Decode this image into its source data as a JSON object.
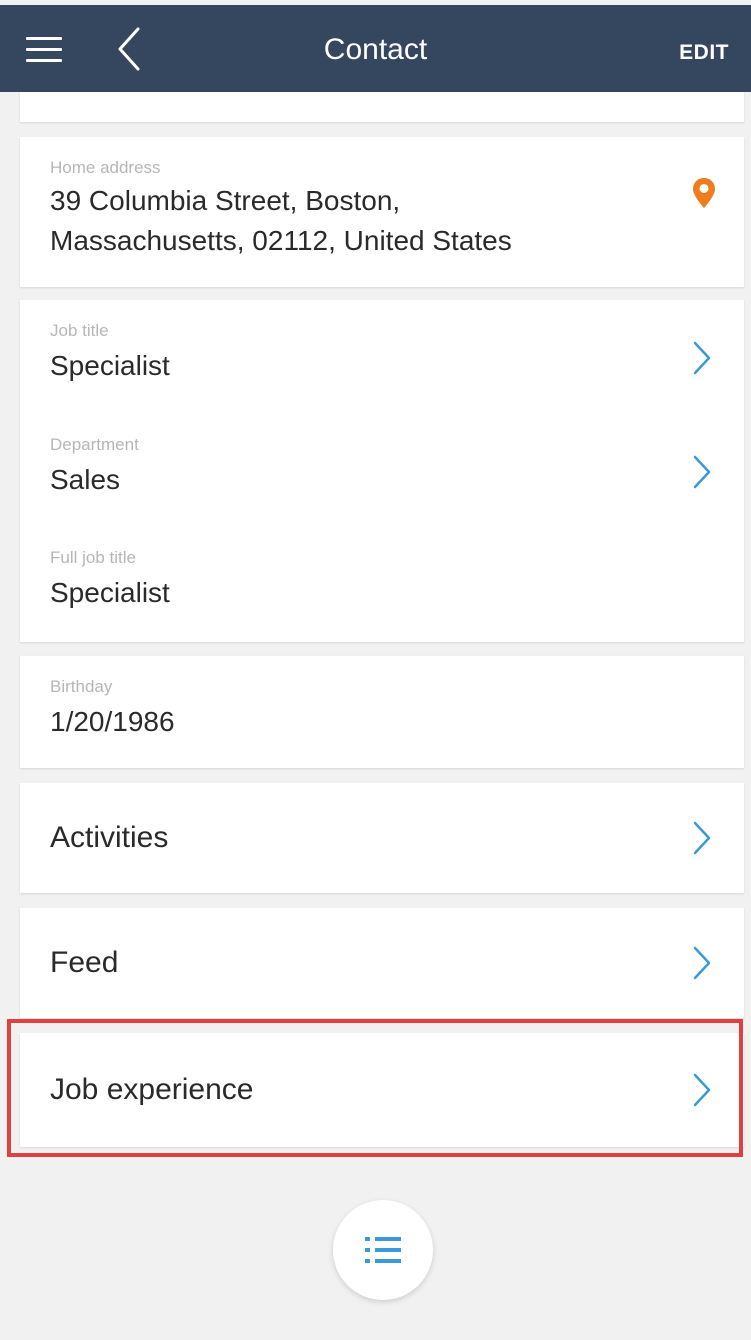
{
  "header": {
    "title": "Contact",
    "edit_label": "EDIT"
  },
  "address_card": {
    "label": "Home address",
    "line1": "39 Columbia Street, Boston,",
    "line2": "Massachusetts, 02112, United States"
  },
  "job_card": {
    "job_title_label": "Job title",
    "job_title_value": "Specialist",
    "department_label": "Department",
    "department_value": "Sales",
    "full_job_title_label": "Full job title",
    "full_job_title_value": "Specialist"
  },
  "birthday_card": {
    "label": "Birthday",
    "value": "1/20/1986"
  },
  "nav_items": {
    "activities": "Activities",
    "feed": "Feed",
    "job_experience": "Job experience"
  },
  "icons": {
    "menu": "hamburger-icon",
    "back": "chevron-left-icon",
    "location": "map-pin-icon",
    "chevron": "chevron-right-icon",
    "list": "list-icon"
  },
  "colors": {
    "header_bg": "#35465f",
    "accent_blue": "#3a9ad9",
    "pin_orange": "#f07c20",
    "highlight_red": "#e04040"
  }
}
